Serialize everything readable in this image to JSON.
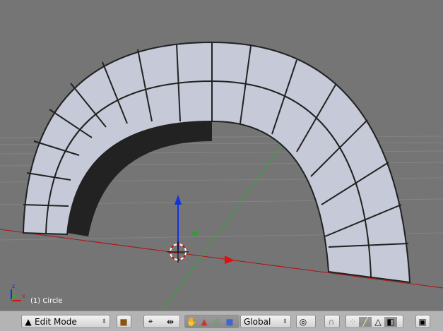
{
  "viewport": {
    "object_info": "(1) Circle",
    "axis_labels": {
      "z": "z",
      "y": "y",
      "x": "x"
    }
  },
  "toolbar": {
    "mode": {
      "label": "Edit Mode",
      "icon": "edit-mode-triangle-icon"
    },
    "draw_type_icon": "solid-cube-icon",
    "pivot_icon": "crosshair-icon",
    "manipulator_icons": [
      "hand-icon",
      "translate-triangle-icon",
      "rotate-ring-icon",
      "scale-square-icon"
    ],
    "orientation": "Global",
    "proportional_icon": "proportional-circle-icon",
    "snap_icon": "magnet-icon",
    "select_modes": [
      "vertex-icon",
      "edge-icon",
      "face-icon",
      "occlude-cube-icon"
    ],
    "render_icon": "render-image-icon"
  },
  "colors": {
    "viewport_bg": "#757575",
    "x_axis": "#cc1111",
    "y_axis": "#33aa33",
    "z_axis": "#1133dd",
    "mesh": "#c6cad8"
  }
}
